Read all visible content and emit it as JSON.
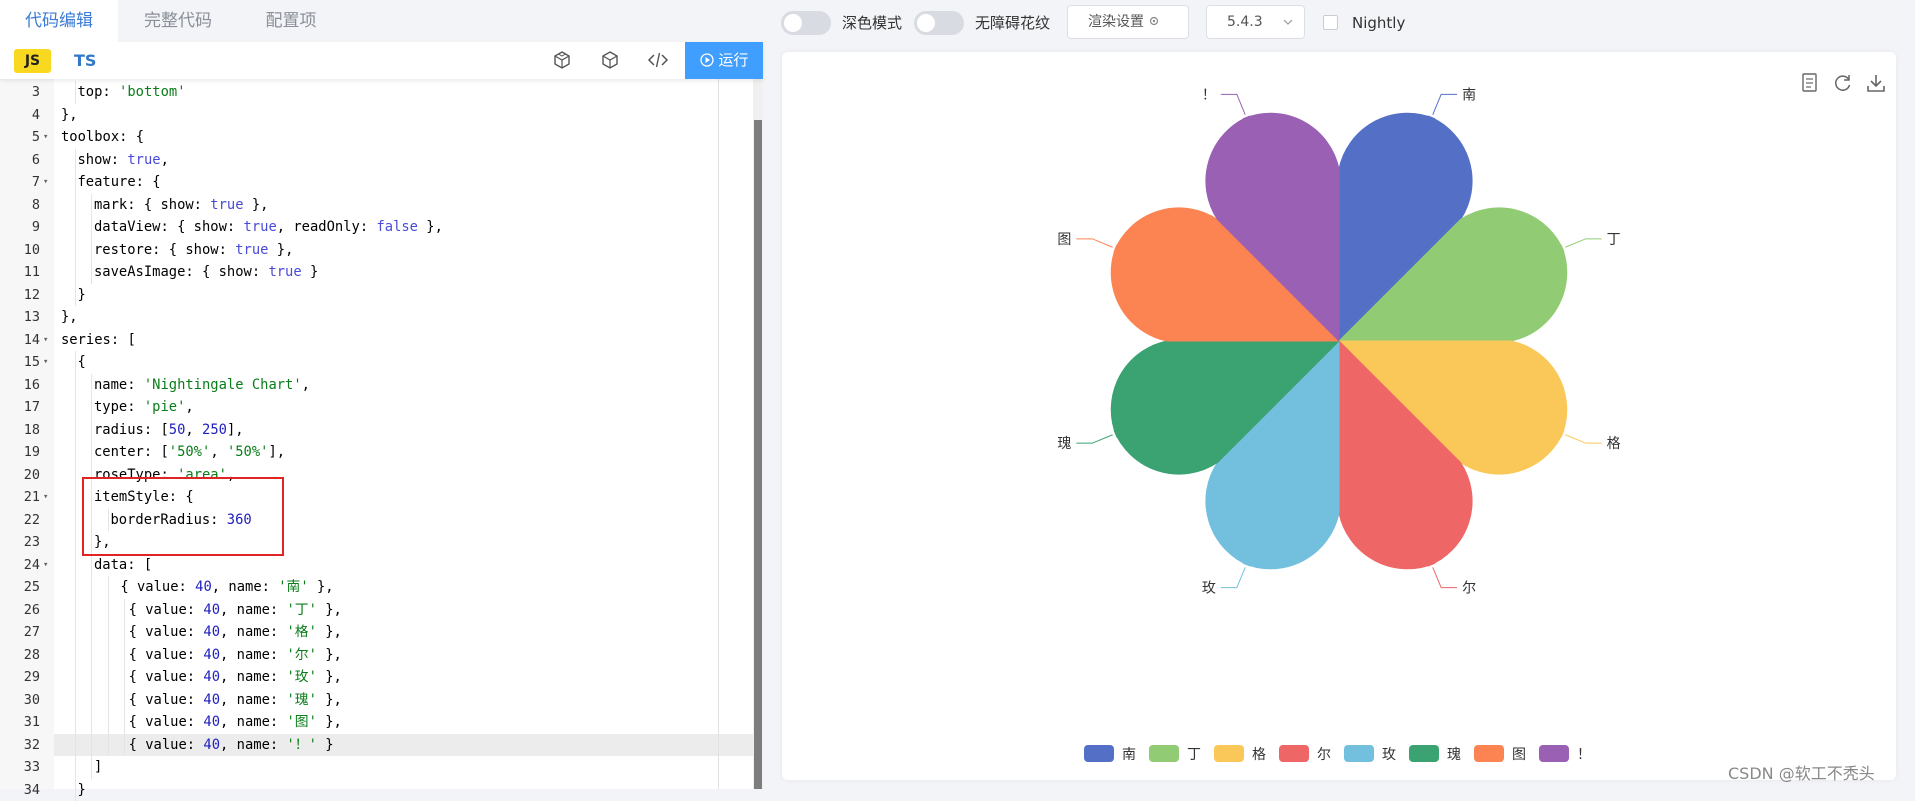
{
  "editor": {
    "tabs": [
      "代码编辑",
      "完整代码",
      "配置项"
    ],
    "lang_js": "JS",
    "lang_ts": "TS",
    "tool_icons": [
      "codesandbox-icon",
      "cube-icon",
      "code-icon"
    ],
    "run_label": "运行",
    "lines": [
      {
        "n": "3",
        "fold": false,
        "indent": 2,
        "parts": [
          [
            "p",
            "top: "
          ],
          [
            "s",
            "'bottom'"
          ]
        ]
      },
      {
        "n": "4",
        "fold": false,
        "indent": 1,
        "parts": [
          [
            "p",
            "},"
          ]
        ]
      },
      {
        "n": "5",
        "fold": true,
        "indent": 1,
        "parts": [
          [
            "p",
            "toolbox: {"
          ]
        ]
      },
      {
        "n": "6",
        "fold": false,
        "indent": 2,
        "parts": [
          [
            "p",
            "show: "
          ],
          [
            "k",
            "true"
          ],
          [
            "p",
            ","
          ]
        ]
      },
      {
        "n": "7",
        "fold": true,
        "indent": 2,
        "parts": [
          [
            "p",
            "feature: {"
          ]
        ]
      },
      {
        "n": "8",
        "fold": false,
        "indent": 3,
        "parts": [
          [
            "p",
            "mark: { show: "
          ],
          [
            "k",
            "true"
          ],
          [
            "p",
            " },"
          ]
        ]
      },
      {
        "n": "9",
        "fold": false,
        "indent": 3,
        "parts": [
          [
            "p",
            "dataView: { show: "
          ],
          [
            "k",
            "true"
          ],
          [
            "p",
            ", readOnly: "
          ],
          [
            "k",
            "false"
          ],
          [
            "p",
            " },"
          ]
        ]
      },
      {
        "n": "10",
        "fold": false,
        "indent": 3,
        "parts": [
          [
            "p",
            "restore: { show: "
          ],
          [
            "k",
            "true"
          ],
          [
            "p",
            " },"
          ]
        ]
      },
      {
        "n": "11",
        "fold": false,
        "indent": 3,
        "parts": [
          [
            "p",
            "saveAsImage: { show: "
          ],
          [
            "k",
            "true"
          ],
          [
            "p",
            " }"
          ]
        ]
      },
      {
        "n": "12",
        "fold": false,
        "indent": 2,
        "parts": [
          [
            "p",
            "}"
          ]
        ]
      },
      {
        "n": "13",
        "fold": false,
        "indent": 1,
        "parts": [
          [
            "p",
            "},"
          ]
        ]
      },
      {
        "n": "14",
        "fold": true,
        "indent": 1,
        "parts": [
          [
            "p",
            "series: ["
          ]
        ]
      },
      {
        "n": "15",
        "fold": true,
        "indent": 2,
        "parts": [
          [
            "p",
            "{"
          ]
        ]
      },
      {
        "n": "16",
        "fold": false,
        "indent": 3,
        "parts": [
          [
            "p",
            "name: "
          ],
          [
            "s",
            "'Nightingale Chart'"
          ],
          [
            "p",
            ","
          ]
        ]
      },
      {
        "n": "17",
        "fold": false,
        "indent": 3,
        "parts": [
          [
            "p",
            "type: "
          ],
          [
            "s",
            "'pie'"
          ],
          [
            "p",
            ","
          ]
        ]
      },
      {
        "n": "18",
        "fold": false,
        "indent": 3,
        "parts": [
          [
            "p",
            "radius: ["
          ],
          [
            "n",
            "50"
          ],
          [
            "p",
            ", "
          ],
          [
            "n",
            "250"
          ],
          [
            "p",
            "],"
          ]
        ]
      },
      {
        "n": "19",
        "fold": false,
        "indent": 3,
        "parts": [
          [
            "p",
            "center: ["
          ],
          [
            "s",
            "'50%'"
          ],
          [
            "p",
            ", "
          ],
          [
            "s",
            "'50%'"
          ],
          [
            "p",
            "],"
          ]
        ]
      },
      {
        "n": "20",
        "fold": false,
        "indent": 3,
        "parts": [
          [
            "p",
            "roseType: "
          ],
          [
            "s",
            "'area'"
          ],
          [
            "p",
            ","
          ]
        ]
      },
      {
        "n": "21",
        "fold": true,
        "indent": 3,
        "parts": [
          [
            "p",
            "itemStyle: {"
          ]
        ]
      },
      {
        "n": "22",
        "fold": false,
        "indent": 4,
        "parts": [
          [
            "p",
            "borderRadius: "
          ],
          [
            "n",
            "360"
          ]
        ]
      },
      {
        "n": "23",
        "fold": false,
        "indent": 3,
        "parts": [
          [
            "p",
            "},"
          ]
        ]
      },
      {
        "n": "24",
        "fold": true,
        "indent": 3,
        "parts": [
          [
            "p",
            "data: ["
          ]
        ]
      },
      {
        "n": "25",
        "fold": false,
        "indent": 4.6,
        "parts": [
          [
            "p",
            "{ value: "
          ],
          [
            "n",
            "40"
          ],
          [
            "p",
            ", name: "
          ],
          [
            "s",
            "'南'"
          ],
          [
            "p",
            " },"
          ]
        ]
      },
      {
        "n": "26",
        "fold": false,
        "indent": 5.1,
        "parts": [
          [
            "p",
            "{ value: "
          ],
          [
            "n",
            "40"
          ],
          [
            "p",
            ", name: "
          ],
          [
            "s",
            "'丁'"
          ],
          [
            "p",
            " },"
          ]
        ]
      },
      {
        "n": "27",
        "fold": false,
        "indent": 5.1,
        "parts": [
          [
            "p",
            "{ value: "
          ],
          [
            "n",
            "40"
          ],
          [
            "p",
            ", name: "
          ],
          [
            "s",
            "'格'"
          ],
          [
            "p",
            " },"
          ]
        ]
      },
      {
        "n": "28",
        "fold": false,
        "indent": 5.1,
        "parts": [
          [
            "p",
            "{ value: "
          ],
          [
            "n",
            "40"
          ],
          [
            "p",
            ", name: "
          ],
          [
            "s",
            "'尔'"
          ],
          [
            "p",
            " },"
          ]
        ]
      },
      {
        "n": "29",
        "fold": false,
        "indent": 5.1,
        "parts": [
          [
            "p",
            "{ value: "
          ],
          [
            "n",
            "40"
          ],
          [
            "p",
            ", name: "
          ],
          [
            "s",
            "'玫'"
          ],
          [
            "p",
            " },"
          ]
        ]
      },
      {
        "n": "30",
        "fold": false,
        "indent": 5.1,
        "parts": [
          [
            "p",
            "{ value: "
          ],
          [
            "n",
            "40"
          ],
          [
            "p",
            ", name: "
          ],
          [
            "s",
            "'瑰'"
          ],
          [
            "p",
            " },"
          ]
        ]
      },
      {
        "n": "31",
        "fold": false,
        "indent": 5.1,
        "parts": [
          [
            "p",
            "{ value: "
          ],
          [
            "n",
            "40"
          ],
          [
            "p",
            ", name: "
          ],
          [
            "s",
            "'图'"
          ],
          [
            "p",
            " },"
          ]
        ]
      },
      {
        "n": "32",
        "fold": false,
        "indent": 5.1,
        "parts": [
          [
            "p",
            "{ value: "
          ],
          [
            "n",
            "40"
          ],
          [
            "p",
            ", name: "
          ],
          [
            "s",
            "'！'"
          ],
          [
            "p",
            " }"
          ]
        ]
      },
      {
        "n": "33",
        "fold": false,
        "indent": 3,
        "parts": [
          [
            "p",
            "]"
          ]
        ]
      },
      {
        "n": "34",
        "fold": false,
        "indent": 2,
        "parts": [
          [
            "p",
            "}"
          ]
        ]
      }
    ],
    "current_line": "32"
  },
  "topbar": {
    "dark_mode_label": "深色模式",
    "dark_mode_on": false,
    "accessible_label": "无障碍花纹",
    "accessible_on": false,
    "render_settings_label": "渲染设置",
    "version": "5.4.3",
    "nightly_label": "Nightly",
    "nightly_checked": false
  },
  "toolbox_icons": [
    "data-view-icon",
    "restore-icon",
    "save-as-image-icon"
  ],
  "chart_data": {
    "type": "pie",
    "rose_type": "area",
    "series_name": "Nightingale Chart",
    "radius": [
      50,
      250
    ],
    "border_radius": 360,
    "legend_position": "bottom",
    "categories": [
      "南",
      "丁",
      "格",
      "尔",
      "玫",
      "瑰",
      "图",
      "！"
    ],
    "values": [
      40,
      40,
      40,
      40,
      40,
      40,
      40,
      40
    ],
    "colors": [
      "#5470c6",
      "#91cc75",
      "#fac858",
      "#ee6666",
      "#73c0de",
      "#3ba272",
      "#fc8452",
      "#9a60b4"
    ]
  },
  "watermark": "CSDN @软工不秃头"
}
